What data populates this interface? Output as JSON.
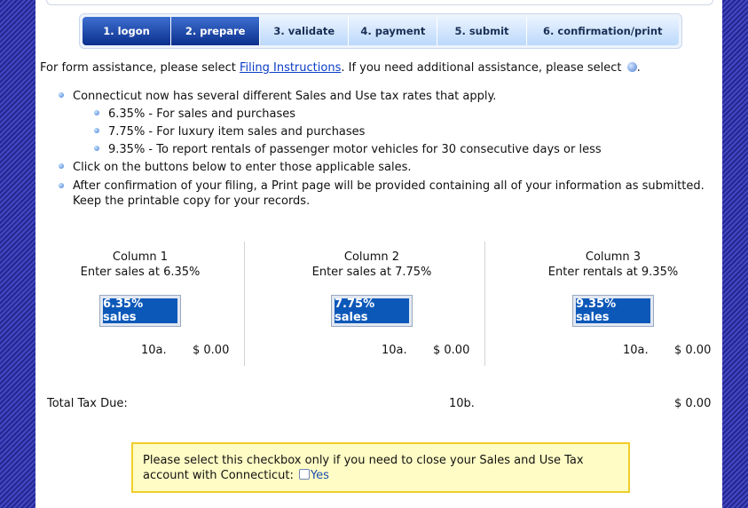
{
  "steps": [
    {
      "label": "1. logon",
      "state": "completed"
    },
    {
      "label": "2. prepare",
      "state": "current"
    },
    {
      "label": "3. validate",
      "state": "pending"
    },
    {
      "label": "4. payment",
      "state": "pending"
    },
    {
      "label": "5. submit",
      "state": "pending"
    },
    {
      "label": "6. confirmation/print",
      "state": "pending"
    }
  ],
  "assistance": {
    "prefix": "For form assistance, please select ",
    "link": "Filing Instructions",
    "suffix": ". If you need additional assistance, please select ",
    "end": "."
  },
  "bullets": {
    "intro": "Connecticut now has several different Sales and Use tax rates that apply.",
    "rates": [
      "6.35% - For sales and purchases",
      "7.75% - For luxury item sales and purchases",
      "9.35% - To report rentals of passenger motor vehicles for 30 consecutive days or less"
    ],
    "click": "Click on the buttons below to enter those applicable sales.",
    "confirm": "After confirmation of your filing, a Print page will be provided containing all of your information as submitted. Keep the printable copy for your records."
  },
  "columns": [
    {
      "title": "Column 1",
      "subtitle": "Enter sales at 6.35%",
      "button": "6.35% sales",
      "line": "10a.",
      "amount": "$ 0.00"
    },
    {
      "title": "Column 2",
      "subtitle": "Enter sales at 7.75%",
      "button": "7.75% sales",
      "line": "10a.",
      "amount": "$ 0.00"
    },
    {
      "title": "Column 3",
      "subtitle": "Enter rentals at 9.35%",
      "button": "9.35% sales",
      "line": "10a.",
      "amount": "$ 0.00"
    }
  ],
  "total": {
    "label": "Total Tax Due:",
    "line": "10b.",
    "amount": "$ 0.00"
  },
  "notice": {
    "text": "Please select this checkbox only if you need to close your Sales and Use Tax account with Connecticut:",
    "checkbox_label": "Yes",
    "checked": false
  },
  "colors": {
    "tab_active": "#0c2f8c",
    "tab_inactive": "#bcd9fb",
    "button": "#0c58b9",
    "link": "#0a3cc7",
    "notice_border": "#f0cd2a",
    "notice_bg": "#fffdc5"
  }
}
